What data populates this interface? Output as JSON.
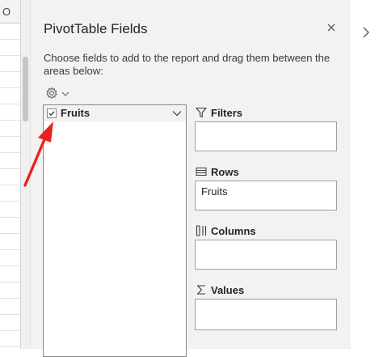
{
  "sheet": {
    "column_letter": "O"
  },
  "pane": {
    "title": "PivotTable Fields",
    "description": "Choose fields to add to the report and drag them between the areas below:",
    "close_icon": "close-icon",
    "tools_icon": "gear-icon"
  },
  "fields": [
    {
      "label": "Fruits",
      "checked": true
    }
  ],
  "areas": {
    "filters": {
      "label": "Filters",
      "items": []
    },
    "rows": {
      "label": "Rows",
      "items": [
        "Fruits"
      ]
    },
    "columns": {
      "label": "Columns",
      "items": []
    },
    "values": {
      "label": "Values",
      "items": []
    }
  },
  "annotation": {
    "arrow_color": "#e8231c"
  },
  "colors": {
    "pane_bg": "#f3f2f1",
    "accent_red": "#e8231c"
  }
}
